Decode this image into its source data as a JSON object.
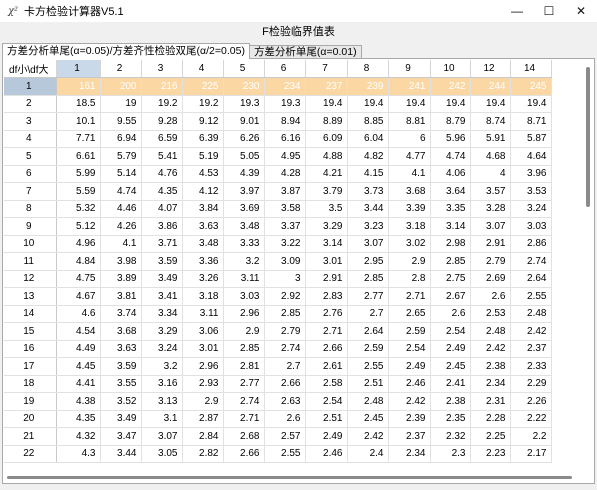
{
  "window": {
    "title": "卡方检验计算器V5.1",
    "icon": "chi-square-icon",
    "controls": {
      "minimize": "—",
      "maximize": "☐",
      "close": "✕"
    }
  },
  "menubar": {
    "item": "F检验临界值表"
  },
  "tabs": [
    {
      "label": "方差分析单尾(α=0.05)/方差齐性检验双尾(α/2=0.05)",
      "active": true
    },
    {
      "label": "方差分析单尾(α=0.01)",
      "active": false
    }
  ],
  "table": {
    "corner_label": "df小\\df大",
    "columns": [
      "1",
      "2",
      "3",
      "4",
      "5",
      "6",
      "7",
      "8",
      "9",
      "10",
      "12",
      "14"
    ],
    "selected_row_index": 0,
    "selected_row_color": "#fbd7a4",
    "rows": [
      {
        "df": "1",
        "values": [
          "161",
          "200",
          "216",
          "225",
          "230",
          "234",
          "237",
          "239",
          "241",
          "242",
          "244",
          "245"
        ]
      },
      {
        "df": "2",
        "values": [
          "18.5",
          "19",
          "19.2",
          "19.2",
          "19.3",
          "19.3",
          "19.4",
          "19.4",
          "19.4",
          "19.4",
          "19.4",
          "19.4"
        ]
      },
      {
        "df": "3",
        "values": [
          "10.1",
          "9.55",
          "9.28",
          "9.12",
          "9.01",
          "8.94",
          "8.89",
          "8.85",
          "8.81",
          "8.79",
          "8.74",
          "8.71"
        ]
      },
      {
        "df": "4",
        "values": [
          "7.71",
          "6.94",
          "6.59",
          "6.39",
          "6.26",
          "6.16",
          "6.09",
          "6.04",
          "6",
          "5.96",
          "5.91",
          "5.87"
        ]
      },
      {
        "df": "5",
        "values": [
          "6.61",
          "5.79",
          "5.41",
          "5.19",
          "5.05",
          "4.95",
          "4.88",
          "4.82",
          "4.77",
          "4.74",
          "4.68",
          "4.64"
        ]
      },
      {
        "df": "6",
        "values": [
          "5.99",
          "5.14",
          "4.76",
          "4.53",
          "4.39",
          "4.28",
          "4.21",
          "4.15",
          "4.1",
          "4.06",
          "4",
          "3.96"
        ]
      },
      {
        "df": "7",
        "values": [
          "5.59",
          "4.74",
          "4.35",
          "4.12",
          "3.97",
          "3.87",
          "3.79",
          "3.73",
          "3.68",
          "3.64",
          "3.57",
          "3.53"
        ]
      },
      {
        "df": "8",
        "values": [
          "5.32",
          "4.46",
          "4.07",
          "3.84",
          "3.69",
          "3.58",
          "3.5",
          "3.44",
          "3.39",
          "3.35",
          "3.28",
          "3.24"
        ]
      },
      {
        "df": "9",
        "values": [
          "5.12",
          "4.26",
          "3.86",
          "3.63",
          "3.48",
          "3.37",
          "3.29",
          "3.23",
          "3.18",
          "3.14",
          "3.07",
          "3.03"
        ]
      },
      {
        "df": "10",
        "values": [
          "4.96",
          "4.1",
          "3.71",
          "3.48",
          "3.33",
          "3.22",
          "3.14",
          "3.07",
          "3.02",
          "2.98",
          "2.91",
          "2.86"
        ]
      },
      {
        "df": "11",
        "values": [
          "4.84",
          "3.98",
          "3.59",
          "3.36",
          "3.2",
          "3.09",
          "3.01",
          "2.95",
          "2.9",
          "2.85",
          "2.79",
          "2.74"
        ]
      },
      {
        "df": "12",
        "values": [
          "4.75",
          "3.89",
          "3.49",
          "3.26",
          "3.11",
          "3",
          "2.91",
          "2.85",
          "2.8",
          "2.75",
          "2.69",
          "2.64"
        ]
      },
      {
        "df": "13",
        "values": [
          "4.67",
          "3.81",
          "3.41",
          "3.18",
          "3.03",
          "2.92",
          "2.83",
          "2.77",
          "2.71",
          "2.67",
          "2.6",
          "2.55"
        ]
      },
      {
        "df": "14",
        "values": [
          "4.6",
          "3.74",
          "3.34",
          "3.11",
          "2.96",
          "2.85",
          "2.76",
          "2.7",
          "2.65",
          "2.6",
          "2.53",
          "2.48"
        ]
      },
      {
        "df": "15",
        "values": [
          "4.54",
          "3.68",
          "3.29",
          "3.06",
          "2.9",
          "2.79",
          "2.71",
          "2.64",
          "2.59",
          "2.54",
          "2.48",
          "2.42"
        ]
      },
      {
        "df": "16",
        "values": [
          "4.49",
          "3.63",
          "3.24",
          "3.01",
          "2.85",
          "2.74",
          "2.66",
          "2.59",
          "2.54",
          "2.49",
          "2.42",
          "2.37"
        ]
      },
      {
        "df": "17",
        "values": [
          "4.45",
          "3.59",
          "3.2",
          "2.96",
          "2.81",
          "2.7",
          "2.61",
          "2.55",
          "2.49",
          "2.45",
          "2.38",
          "2.33"
        ]
      },
      {
        "df": "18",
        "values": [
          "4.41",
          "3.55",
          "3.16",
          "2.93",
          "2.77",
          "2.66",
          "2.58",
          "2.51",
          "2.46",
          "2.41",
          "2.34",
          "2.29"
        ]
      },
      {
        "df": "19",
        "values": [
          "4.38",
          "3.52",
          "3.13",
          "2.9",
          "2.74",
          "2.63",
          "2.54",
          "2.48",
          "2.42",
          "2.38",
          "2.31",
          "2.26"
        ]
      },
      {
        "df": "20",
        "values": [
          "4.35",
          "3.49",
          "3.1",
          "2.87",
          "2.71",
          "2.6",
          "2.51",
          "2.45",
          "2.39",
          "2.35",
          "2.28",
          "2.22"
        ]
      },
      {
        "df": "21",
        "values": [
          "4.32",
          "3.47",
          "3.07",
          "2.84",
          "2.68",
          "2.57",
          "2.49",
          "2.42",
          "2.37",
          "2.32",
          "2.25",
          "2.2"
        ]
      },
      {
        "df": "22",
        "values": [
          "4.3",
          "3.44",
          "3.05",
          "2.82",
          "2.66",
          "2.55",
          "2.46",
          "2.4",
          "2.34",
          "2.3",
          "2.23",
          "2.17"
        ]
      }
    ]
  }
}
